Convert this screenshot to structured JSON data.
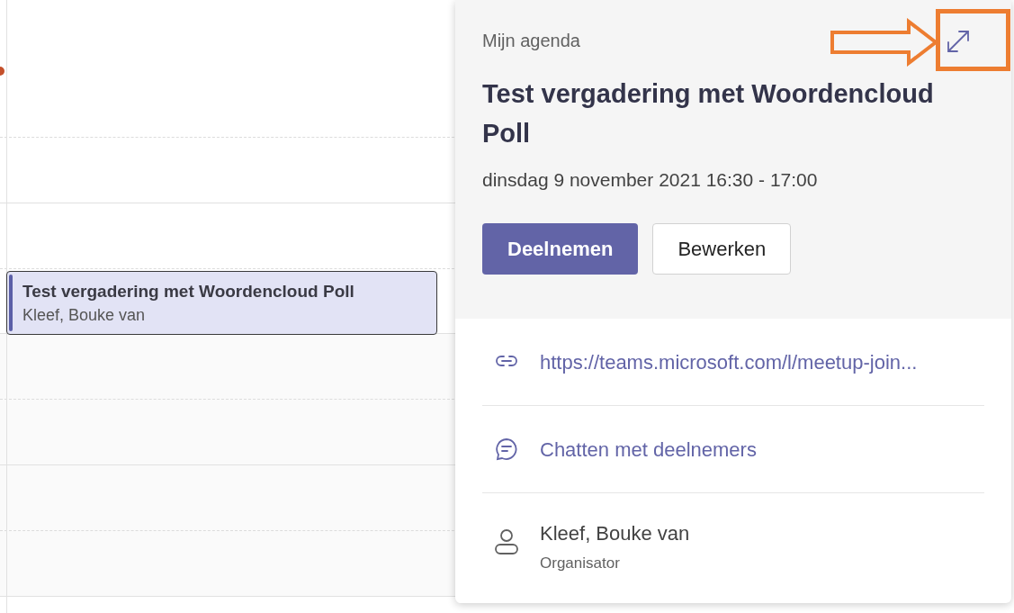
{
  "calendar": {
    "event": {
      "title": "Test vergadering met Woordencloud Poll",
      "organizer": "Kleef, Bouke van"
    }
  },
  "popup": {
    "calendar_label": "Mijn agenda",
    "title": "Test vergadering met Woordencloud Poll",
    "datetime": "dinsdag 9 november 2021 16:30 - 17:00",
    "buttons": [
      {
        "label": "Deelnemen",
        "kind": "primary"
      },
      {
        "label": "Bewerken",
        "kind": "secondary"
      }
    ],
    "details": [
      {
        "kind": "link",
        "text": "https://teams.microsoft.com/l/meetup-join..."
      },
      {
        "kind": "chat",
        "text": "Chatten met deelnemers"
      }
    ],
    "organizer": {
      "name": "Kleef, Bouke van",
      "role": "Organisator"
    }
  }
}
